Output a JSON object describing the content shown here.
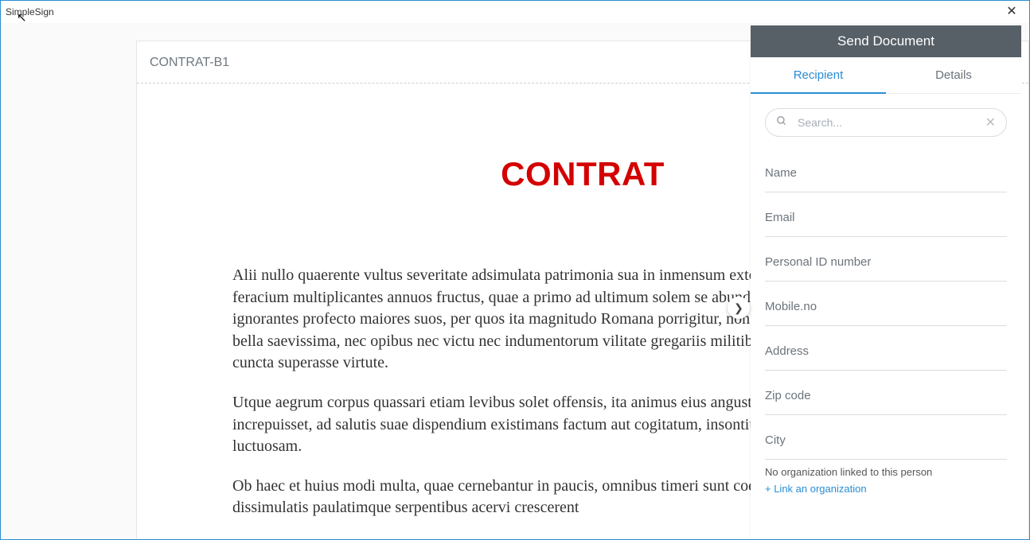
{
  "window": {
    "title": "SimpleSign"
  },
  "document": {
    "file_label": "CONTRAT-B1",
    "title": "CONTRAT",
    "para1": "Alii nullo quaerente vultus severitate adsimulata patrimonia sua in inmensum extollunt, cultorum ut puta feracium multiplicantes annuos fructus, quae a primo ad ultimum solem se abunde iactitant possidere, ignorantes profecto maiores suos, per quos ita magnitudo Romana porrigitur, non divitiis eluxisse sed per bella saevissima, nec opibus nec victu nec indumentorum vilitate gregariis militibus discrepantes opposita cuncta superasse virtute.",
    "para2": "Utque aegrum corpus quassari etiam levibus solet offensis, ita animus eius angustus et tener, quicquid increpuisset, ad salutis suae dispendium existimans factum aut cogitatum, insontium caedibus fecit victoriam luctuosam.",
    "para3": "Ob haec et huius modi multa, quae cernebantur in paucis, omnibus timeri sunt coepta. et ne tot malis dissimulatis paulatimque serpentibus acervi crescerent"
  },
  "panel": {
    "header": "Send Document",
    "tabs": {
      "recipient": "Recipient",
      "details": "Details"
    },
    "search_placeholder": "Search...",
    "fields": {
      "name": "Name",
      "email": "Email",
      "personal_id": "Personal ID number",
      "mobile": "Mobile.no",
      "address": "Address",
      "zip": "Zip code",
      "city": "City"
    },
    "org_note": "No organization linked to this person",
    "org_link": "+ Link an organization"
  }
}
